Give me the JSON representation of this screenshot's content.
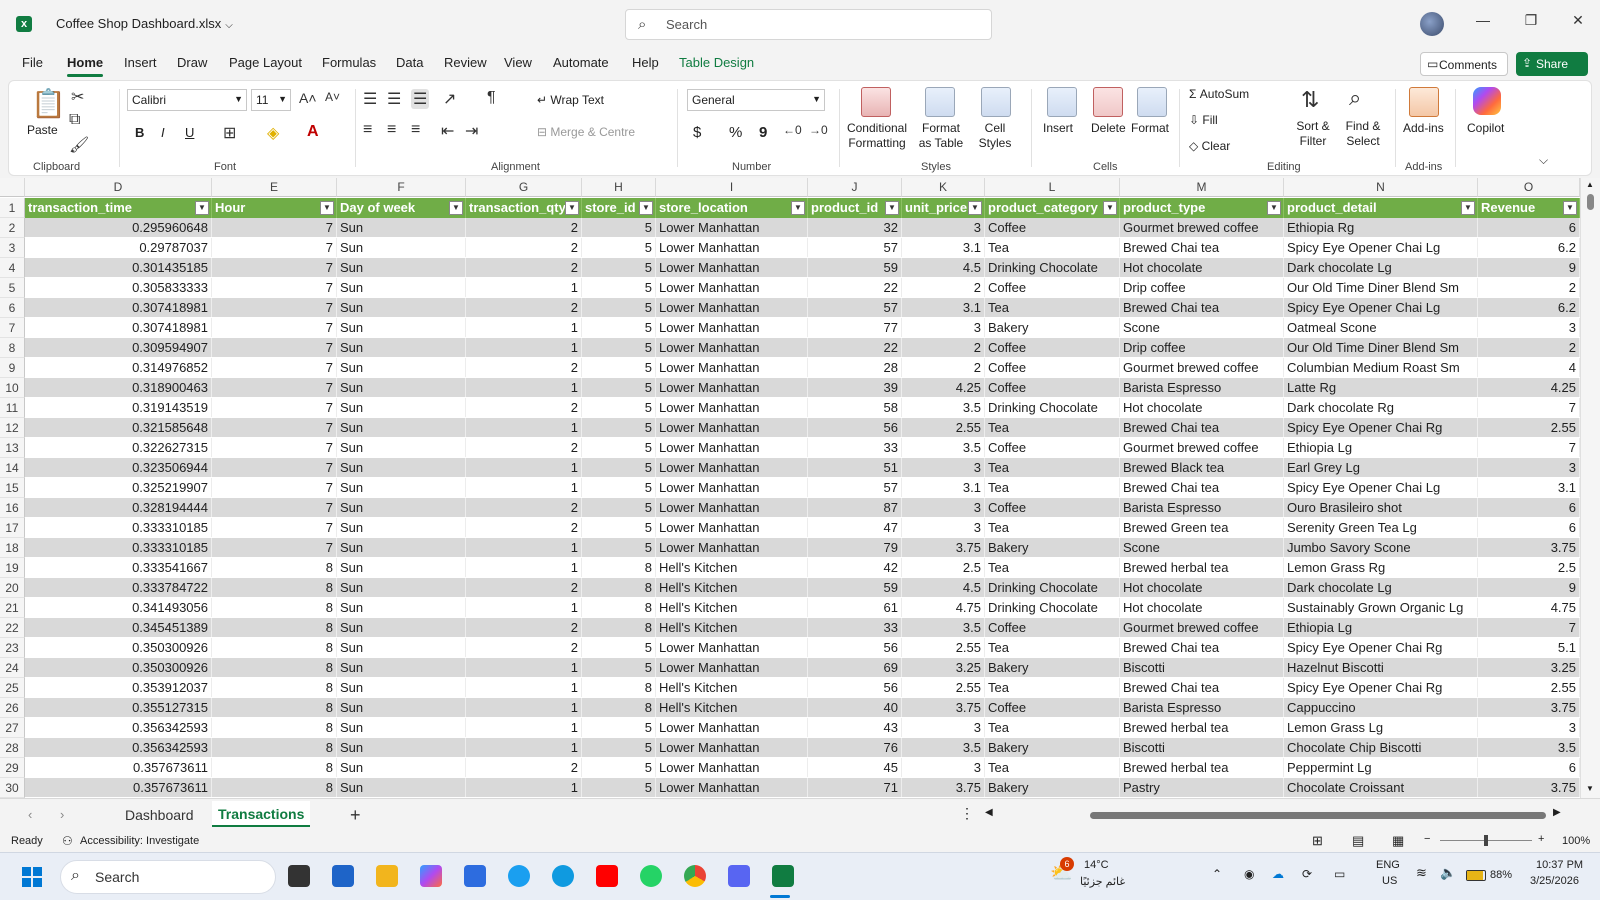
{
  "window": {
    "title": "Coffee Shop Dashboard.xlsx",
    "search_placeholder": "Search",
    "minimize": "—",
    "maximize": "❐",
    "close": "✕"
  },
  "menu": {
    "tabs": [
      "File",
      "Home",
      "Insert",
      "Draw",
      "Page Layout",
      "Formulas",
      "Data",
      "Review",
      "View",
      "Automate",
      "Help",
      "Table Design"
    ],
    "active": "Home",
    "comments_label": "Comments",
    "share_label": "Share"
  },
  "ribbon": {
    "clipboard": {
      "paste": "Paste",
      "label": "Clipboard"
    },
    "font": {
      "name": "Calibri",
      "size": "11",
      "label": "Font",
      "bold": "B",
      "italic": "I",
      "underline": "U"
    },
    "alignment": {
      "wrap_text": "Wrap Text",
      "merge": "Merge & Centre",
      "label": "Alignment"
    },
    "number": {
      "format": "General",
      "label": "Number",
      "currency": "$",
      "percent": "%",
      "comma": "9"
    },
    "styles": {
      "conditional": "Conditional Formatting",
      "format_table": "Format as Table",
      "cell_styles": "Cell Styles",
      "label": "Styles"
    },
    "cells": {
      "insert": "Insert",
      "delete": "Delete",
      "format": "Format",
      "label": "Cells"
    },
    "editing": {
      "autosum": "AutoSum",
      "fill": "Fill",
      "clear": "Clear",
      "sort_filter": "Sort & Filter",
      "find_select": "Find & Select",
      "label": "Editing"
    },
    "addins": {
      "addins": "Add-ins",
      "label": "Add-ins"
    },
    "copilot": {
      "label": "Copilot"
    }
  },
  "grid": {
    "column_letters": [
      "D",
      "E",
      "F",
      "G",
      "H",
      "I",
      "J",
      "K",
      "L",
      "M",
      "N",
      "O"
    ],
    "headers": [
      "transaction_time",
      "Hour",
      "Day of week",
      "transaction_qty",
      "store_id",
      "store_location",
      "product_id",
      "unit_price",
      "product_category",
      "product_type",
      "product_detail",
      "Revenue"
    ],
    "rows": [
      [
        "0.295960648",
        "7",
        "Sun",
        "2",
        "5",
        "Lower Manhattan",
        "32",
        "3",
        "Coffee",
        "Gourmet brewed coffee",
        "Ethiopia Rg",
        "6"
      ],
      [
        "0.29787037",
        "7",
        "Sun",
        "2",
        "5",
        "Lower Manhattan",
        "57",
        "3.1",
        "Tea",
        "Brewed Chai tea",
        "Spicy Eye Opener Chai Lg",
        "6.2"
      ],
      [
        "0.301435185",
        "7",
        "Sun",
        "2",
        "5",
        "Lower Manhattan",
        "59",
        "4.5",
        "Drinking Chocolate",
        "Hot chocolate",
        "Dark chocolate Lg",
        "9"
      ],
      [
        "0.305833333",
        "7",
        "Sun",
        "1",
        "5",
        "Lower Manhattan",
        "22",
        "2",
        "Coffee",
        "Drip coffee",
        "Our Old Time Diner Blend Sm",
        "2"
      ],
      [
        "0.307418981",
        "7",
        "Sun",
        "2",
        "5",
        "Lower Manhattan",
        "57",
        "3.1",
        "Tea",
        "Brewed Chai tea",
        "Spicy Eye Opener Chai Lg",
        "6.2"
      ],
      [
        "0.307418981",
        "7",
        "Sun",
        "1",
        "5",
        "Lower Manhattan",
        "77",
        "3",
        "Bakery",
        "Scone",
        "Oatmeal Scone",
        "3"
      ],
      [
        "0.309594907",
        "7",
        "Sun",
        "1",
        "5",
        "Lower Manhattan",
        "22",
        "2",
        "Coffee",
        "Drip coffee",
        "Our Old Time Diner Blend Sm",
        "2"
      ],
      [
        "0.314976852",
        "7",
        "Sun",
        "2",
        "5",
        "Lower Manhattan",
        "28",
        "2",
        "Coffee",
        "Gourmet brewed coffee",
        "Columbian Medium Roast Sm",
        "4"
      ],
      [
        "0.318900463",
        "7",
        "Sun",
        "1",
        "5",
        "Lower Manhattan",
        "39",
        "4.25",
        "Coffee",
        "Barista Espresso",
        "Latte Rg",
        "4.25"
      ],
      [
        "0.319143519",
        "7",
        "Sun",
        "2",
        "5",
        "Lower Manhattan",
        "58",
        "3.5",
        "Drinking Chocolate",
        "Hot chocolate",
        "Dark chocolate Rg",
        "7"
      ],
      [
        "0.321585648",
        "7",
        "Sun",
        "1",
        "5",
        "Lower Manhattan",
        "56",
        "2.55",
        "Tea",
        "Brewed Chai tea",
        "Spicy Eye Opener Chai Rg",
        "2.55"
      ],
      [
        "0.322627315",
        "7",
        "Sun",
        "2",
        "5",
        "Lower Manhattan",
        "33",
        "3.5",
        "Coffee",
        "Gourmet brewed coffee",
        "Ethiopia Lg",
        "7"
      ],
      [
        "0.323506944",
        "7",
        "Sun",
        "1",
        "5",
        "Lower Manhattan",
        "51",
        "3",
        "Tea",
        "Brewed Black tea",
        "Earl Grey Lg",
        "3"
      ],
      [
        "0.325219907",
        "7",
        "Sun",
        "1",
        "5",
        "Lower Manhattan",
        "57",
        "3.1",
        "Tea",
        "Brewed Chai tea",
        "Spicy Eye Opener Chai Lg",
        "3.1"
      ],
      [
        "0.328194444",
        "7",
        "Sun",
        "2",
        "5",
        "Lower Manhattan",
        "87",
        "3",
        "Coffee",
        "Barista Espresso",
        "Ouro Brasileiro shot",
        "6"
      ],
      [
        "0.333310185",
        "7",
        "Sun",
        "2",
        "5",
        "Lower Manhattan",
        "47",
        "3",
        "Tea",
        "Brewed Green tea",
        "Serenity Green Tea Lg",
        "6"
      ],
      [
        "0.333310185",
        "7",
        "Sun",
        "1",
        "5",
        "Lower Manhattan",
        "79",
        "3.75",
        "Bakery",
        "Scone",
        "Jumbo Savory Scone",
        "3.75"
      ],
      [
        "0.333541667",
        "8",
        "Sun",
        "1",
        "8",
        "Hell's Kitchen",
        "42",
        "2.5",
        "Tea",
        "Brewed herbal tea",
        "Lemon Grass Rg",
        "2.5"
      ],
      [
        "0.333784722",
        "8",
        "Sun",
        "2",
        "8",
        "Hell's Kitchen",
        "59",
        "4.5",
        "Drinking Chocolate",
        "Hot chocolate",
        "Dark chocolate Lg",
        "9"
      ],
      [
        "0.341493056",
        "8",
        "Sun",
        "1",
        "8",
        "Hell's Kitchen",
        "61",
        "4.75",
        "Drinking Chocolate",
        "Hot chocolate",
        "Sustainably Grown Organic Lg",
        "4.75"
      ],
      [
        "0.345451389",
        "8",
        "Sun",
        "2",
        "8",
        "Hell's Kitchen",
        "33",
        "3.5",
        "Coffee",
        "Gourmet brewed coffee",
        "Ethiopia Lg",
        "7"
      ],
      [
        "0.350300926",
        "8",
        "Sun",
        "2",
        "5",
        "Lower Manhattan",
        "56",
        "2.55",
        "Tea",
        "Brewed Chai tea",
        "Spicy Eye Opener Chai Rg",
        "5.1"
      ],
      [
        "0.350300926",
        "8",
        "Sun",
        "1",
        "5",
        "Lower Manhattan",
        "69",
        "3.25",
        "Bakery",
        "Biscotti",
        "Hazelnut Biscotti",
        "3.25"
      ],
      [
        "0.353912037",
        "8",
        "Sun",
        "1",
        "8",
        "Hell's Kitchen",
        "56",
        "2.55",
        "Tea",
        "Brewed Chai tea",
        "Spicy Eye Opener Chai Rg",
        "2.55"
      ],
      [
        "0.355127315",
        "8",
        "Sun",
        "1",
        "8",
        "Hell's Kitchen",
        "40",
        "3.75",
        "Coffee",
        "Barista Espresso",
        "Cappuccino",
        "3.75"
      ],
      [
        "0.356342593",
        "8",
        "Sun",
        "1",
        "5",
        "Lower Manhattan",
        "43",
        "3",
        "Tea",
        "Brewed herbal tea",
        "Lemon Grass Lg",
        "3"
      ],
      [
        "0.356342593",
        "8",
        "Sun",
        "1",
        "5",
        "Lower Manhattan",
        "76",
        "3.5",
        "Bakery",
        "Biscotti",
        "Chocolate Chip Biscotti",
        "3.5"
      ],
      [
        "0.357673611",
        "8",
        "Sun",
        "2",
        "5",
        "Lower Manhattan",
        "45",
        "3",
        "Tea",
        "Brewed herbal tea",
        "Peppermint Lg",
        "6"
      ],
      [
        "0.357673611",
        "8",
        "Sun",
        "1",
        "5",
        "Lower Manhattan",
        "71",
        "3.75",
        "Bakery",
        "Pastry",
        "Chocolate Croissant",
        "3.75"
      ]
    ]
  },
  "sheets": {
    "tabs": [
      "Dashboard",
      "Transactions"
    ],
    "active": "Transactions"
  },
  "status": {
    "ready": "Ready",
    "accessibility": "Accessibility: Investigate",
    "zoom": "100%"
  },
  "taskbar": {
    "search": "Search",
    "weather_temp": "14°C",
    "weather_desc": "غائم جزئيًا",
    "weather_badge": "6",
    "lang_top": "ENG",
    "lang_bottom": "US",
    "battery": "88%",
    "time": "10:37 PM",
    "date": "3/25/2026"
  },
  "colors": {
    "accent": "#107c41",
    "table_header": "#70ad47",
    "band": "#d9d9d9"
  }
}
